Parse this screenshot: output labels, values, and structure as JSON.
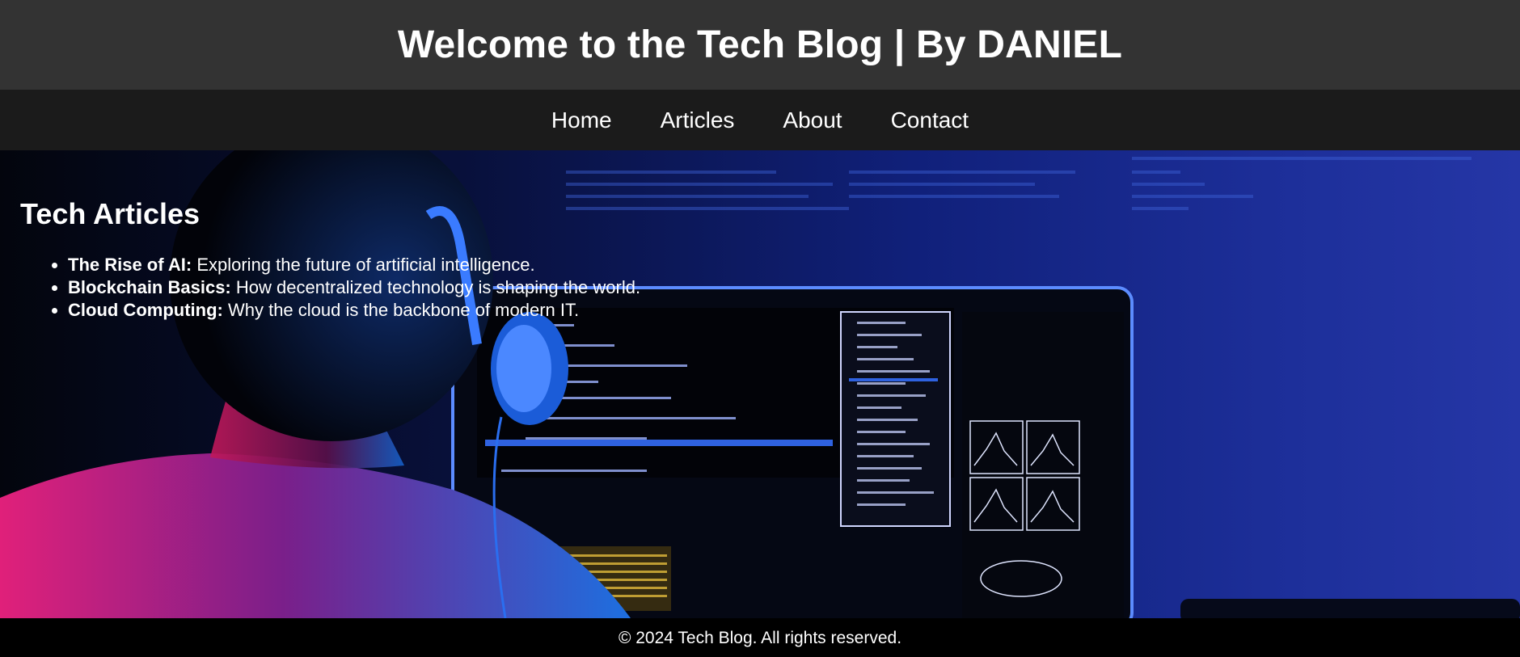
{
  "header": {
    "title": "Welcome to the Tech Blog | By DANIEL"
  },
  "nav": {
    "items": [
      "Home",
      "Articles",
      "About",
      "Contact"
    ]
  },
  "main": {
    "section_title": "Tech Articles",
    "articles": [
      {
        "title": "The Rise of AI:",
        "desc": "Exploring the future of artificial intelligence."
      },
      {
        "title": "Blockchain Basics:",
        "desc": "How decentralized technology is shaping the world."
      },
      {
        "title": "Cloud Computing:",
        "desc": "Why the cloud is the backbone of modern IT."
      }
    ]
  },
  "footer": {
    "text": "© 2024 Tech Blog. All rights reserved."
  },
  "colors": {
    "header_bg": "#333333",
    "nav_bg": "#1b1b1b",
    "text": "#ffffff"
  }
}
